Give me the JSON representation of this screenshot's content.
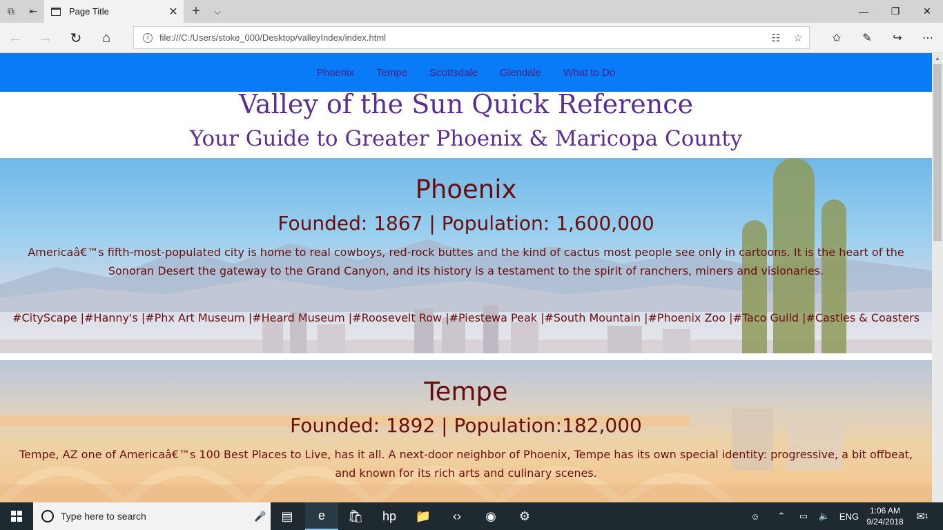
{
  "browser": {
    "tab_title": "Page Title",
    "address": "file:///C:/Users/stoke_000/Desktop/valleyIndex/index.html"
  },
  "nav": {
    "links": [
      "Phoenix",
      "Tempe",
      "Scottsdale",
      "Glendale",
      "What to Do"
    ]
  },
  "hero": {
    "title": "Valley of the Sun Quick Reference",
    "subtitle": "Your Guide to Greater Phoenix & Maricopa County"
  },
  "cities": {
    "phoenix": {
      "name": "Phoenix",
      "stats": "Founded: 1867 | Population: 1,600,000",
      "description": "Americaâ€™s fifth-most-populated city is home to real cowboys, red-rock buttes and the kind of cactus most people see only in cartoons. It is the heart of the Sonoran Desert the gateway to the Grand Canyon, and its history is a testament to the spirit of ranchers, miners and visionaries.",
      "tags": "#CityScape |#Hanny's |#Phx Art Museum |#Heard Museum |#Roosevelt Row |#Piestewa Peak |#South Mountain |#Phoenix Zoo |#Taco Guild |#Castles & Coasters"
    },
    "tempe": {
      "name": "Tempe",
      "stats": "Founded: 1892 | Population:182,000",
      "description": "Tempe, AZ one of Americaâ€™s 100 Best Places to Live, has it all. A next-door neighbor of Phoenix, Tempe has its own special identity: progressive, a bit offbeat, and known for its rich arts and culinary scenes."
    }
  },
  "taskbar": {
    "search_placeholder": "Type here to search",
    "language": "ENG",
    "time": "1:06 AM",
    "date": "9/24/2018",
    "notification_count": "1"
  },
  "colors": {
    "nav_bg": "#0a7bf7",
    "nav_link": "#4b1f8a",
    "hero_text": "#5b2e91",
    "city_text": "#6a0d0d"
  }
}
